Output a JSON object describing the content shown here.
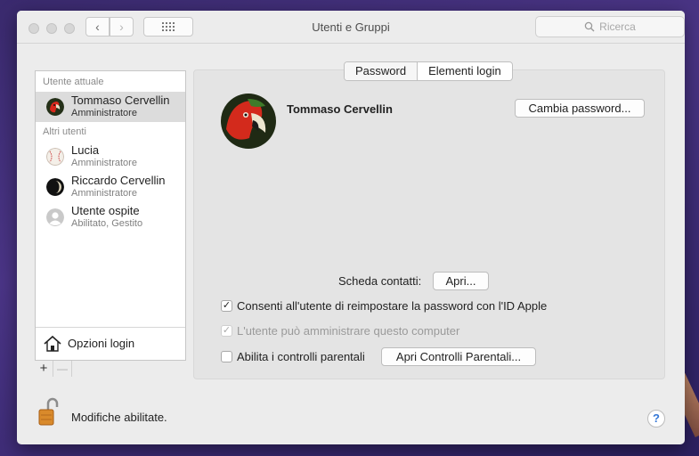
{
  "window": {
    "title": "Utenti e Gruppi"
  },
  "toolbar": {
    "back_icon": "chevron-left",
    "forward_icon": "chevron-right",
    "grid_icon": "grid",
    "search_placeholder": "Ricerca"
  },
  "sidebar": {
    "current_header": "Utente attuale",
    "current_user": {
      "name": "Tommaso Cervellin",
      "role": "Amministratore",
      "avatar": "parrot"
    },
    "others_header": "Altri utenti",
    "others": [
      {
        "name": "Lucia",
        "role": "Amministratore",
        "avatar": "baseball"
      },
      {
        "name": "Riccardo Cervellin",
        "role": "Amministratore",
        "avatar": "moon"
      },
      {
        "name": "Utente ospite",
        "role": "Abilitato, Gestito",
        "avatar": "generic-user"
      }
    ],
    "login_options": "Opzioni login",
    "add": "+",
    "remove": "—"
  },
  "tabs": [
    "Password",
    "Elementi login"
  ],
  "main": {
    "user_name": "Tommaso Cervellin",
    "change_password": "Cambia password...",
    "contacts_label": "Scheda contatti:",
    "open_button": "Apri...",
    "options": [
      {
        "label": "Consenti all'utente di reimpostare la password con l'ID Apple",
        "checked": true,
        "enabled": true
      },
      {
        "label": "L'utente può amministrare questo computer",
        "checked": true,
        "enabled": false
      },
      {
        "label": "Abilita i controlli parentali",
        "checked": false,
        "enabled": true
      }
    ],
    "parental_button": "Apri Controlli Parentali..."
  },
  "footer": {
    "lock_text": "Modifiche abilitate.",
    "help": "?"
  }
}
